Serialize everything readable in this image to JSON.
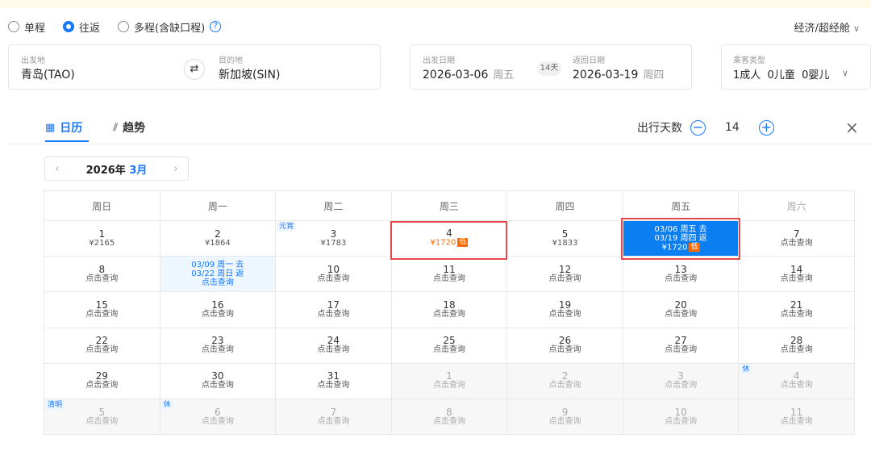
{
  "trip_types": {
    "oneway": "单程",
    "roundtrip": "往返",
    "multi": "多程(含缺口程)",
    "help": "?"
  },
  "cabin": {
    "label": "经济/超经舱",
    "chevron": "∨"
  },
  "search": {
    "from_label": "出发地",
    "from_value": "青岛(TAO)",
    "swap": "⇄",
    "to_label": "目的地",
    "to_value": "新加坡(SIN)",
    "depart_label": "出发日期",
    "depart_value": "2026-03-06",
    "depart_week": "周五",
    "days_badge": "14天",
    "return_label": "返回日期",
    "return_value": "2026-03-19",
    "return_week": "周四",
    "pax_label": "乘客类型",
    "pax_value": "1成人  0儿童  0婴儿",
    "pax_chevron": "∨"
  },
  "tabs": {
    "calendar": "日历",
    "trend": "趋势",
    "calendar_icon": "▦",
    "trend_icon": "⫽"
  },
  "trip_days": {
    "label": "出行天数",
    "minus": "−",
    "value": "14",
    "plus": "+"
  },
  "close": "×",
  "month": {
    "prev": "‹",
    "year": "2026年",
    "month": "3月",
    "next": "›"
  },
  "weekdays": [
    "周日",
    "周一",
    "周二",
    "周三",
    "周四",
    "周五",
    "周六"
  ],
  "cells": [
    {
      "d": "1",
      "p": "¥2165"
    },
    {
      "d": "2",
      "p": "¥1864"
    },
    {
      "d": "3",
      "p": "¥1783",
      "tag": "元宵"
    },
    {
      "d": "4",
      "p": "¥1720",
      "low": "低"
    },
    {
      "d": "5",
      "p": "¥1833"
    },
    {
      "sel": [
        "03/06 周五 去",
        "03/19 周四 返",
        "¥1720"
      ],
      "low": "低"
    },
    {
      "d": "7",
      "p": "点击查询"
    },
    {
      "d": "8",
      "p": "点击查询"
    },
    {
      "range": [
        "03/09 周一 去",
        "03/22 周日 返",
        "点击查询"
      ]
    },
    {
      "d": "10",
      "p": "点击查询"
    },
    {
      "d": "11",
      "p": "点击查询"
    },
    {
      "d": "12",
      "p": "点击查询"
    },
    {
      "d": "13",
      "p": "点击查询"
    },
    {
      "d": "14",
      "p": "点击查询"
    },
    {
      "d": "15",
      "p": "点击查询"
    },
    {
      "d": "16",
      "p": "点击查询"
    },
    {
      "d": "17",
      "p": "点击查询"
    },
    {
      "d": "18",
      "p": "点击查询"
    },
    {
      "d": "19",
      "p": "点击查询"
    },
    {
      "d": "20",
      "p": "点击查询"
    },
    {
      "d": "21",
      "p": "点击查询"
    },
    {
      "d": "22",
      "p": "点击查询"
    },
    {
      "d": "23",
      "p": "点击查询"
    },
    {
      "d": "24",
      "p": "点击查询"
    },
    {
      "d": "25",
      "p": "点击查询"
    },
    {
      "d": "26",
      "p": "点击查询"
    },
    {
      "d": "27",
      "p": "点击查询"
    },
    {
      "d": "28",
      "p": "点击查询"
    },
    {
      "d": "29",
      "p": "点击查询"
    },
    {
      "d": "30",
      "p": "点击查询"
    },
    {
      "d": "31",
      "p": "点击查询"
    },
    {
      "d": "1",
      "p": "点击查询",
      "grey": true
    },
    {
      "d": "2",
      "p": "点击查询",
      "grey": true
    },
    {
      "d": "3",
      "p": "点击查询",
      "grey": true
    },
    {
      "d": "4",
      "p": "点击查询",
      "grey": true,
      "tag": "休"
    },
    {
      "d": "5",
      "p": "点击查询",
      "grey": true,
      "tag": "清明"
    },
    {
      "d": "6",
      "p": "点击查询",
      "grey": true,
      "tag": "休"
    },
    {
      "d": "7",
      "p": "点击查询",
      "grey": true
    },
    {
      "d": "8",
      "p": "点击查询",
      "grey": true
    },
    {
      "d": "9",
      "p": "点击查询",
      "grey": true
    },
    {
      "d": "10",
      "p": "点击查询",
      "grey": true
    },
    {
      "d": "11",
      "p": "点击查询",
      "grey": true
    }
  ]
}
